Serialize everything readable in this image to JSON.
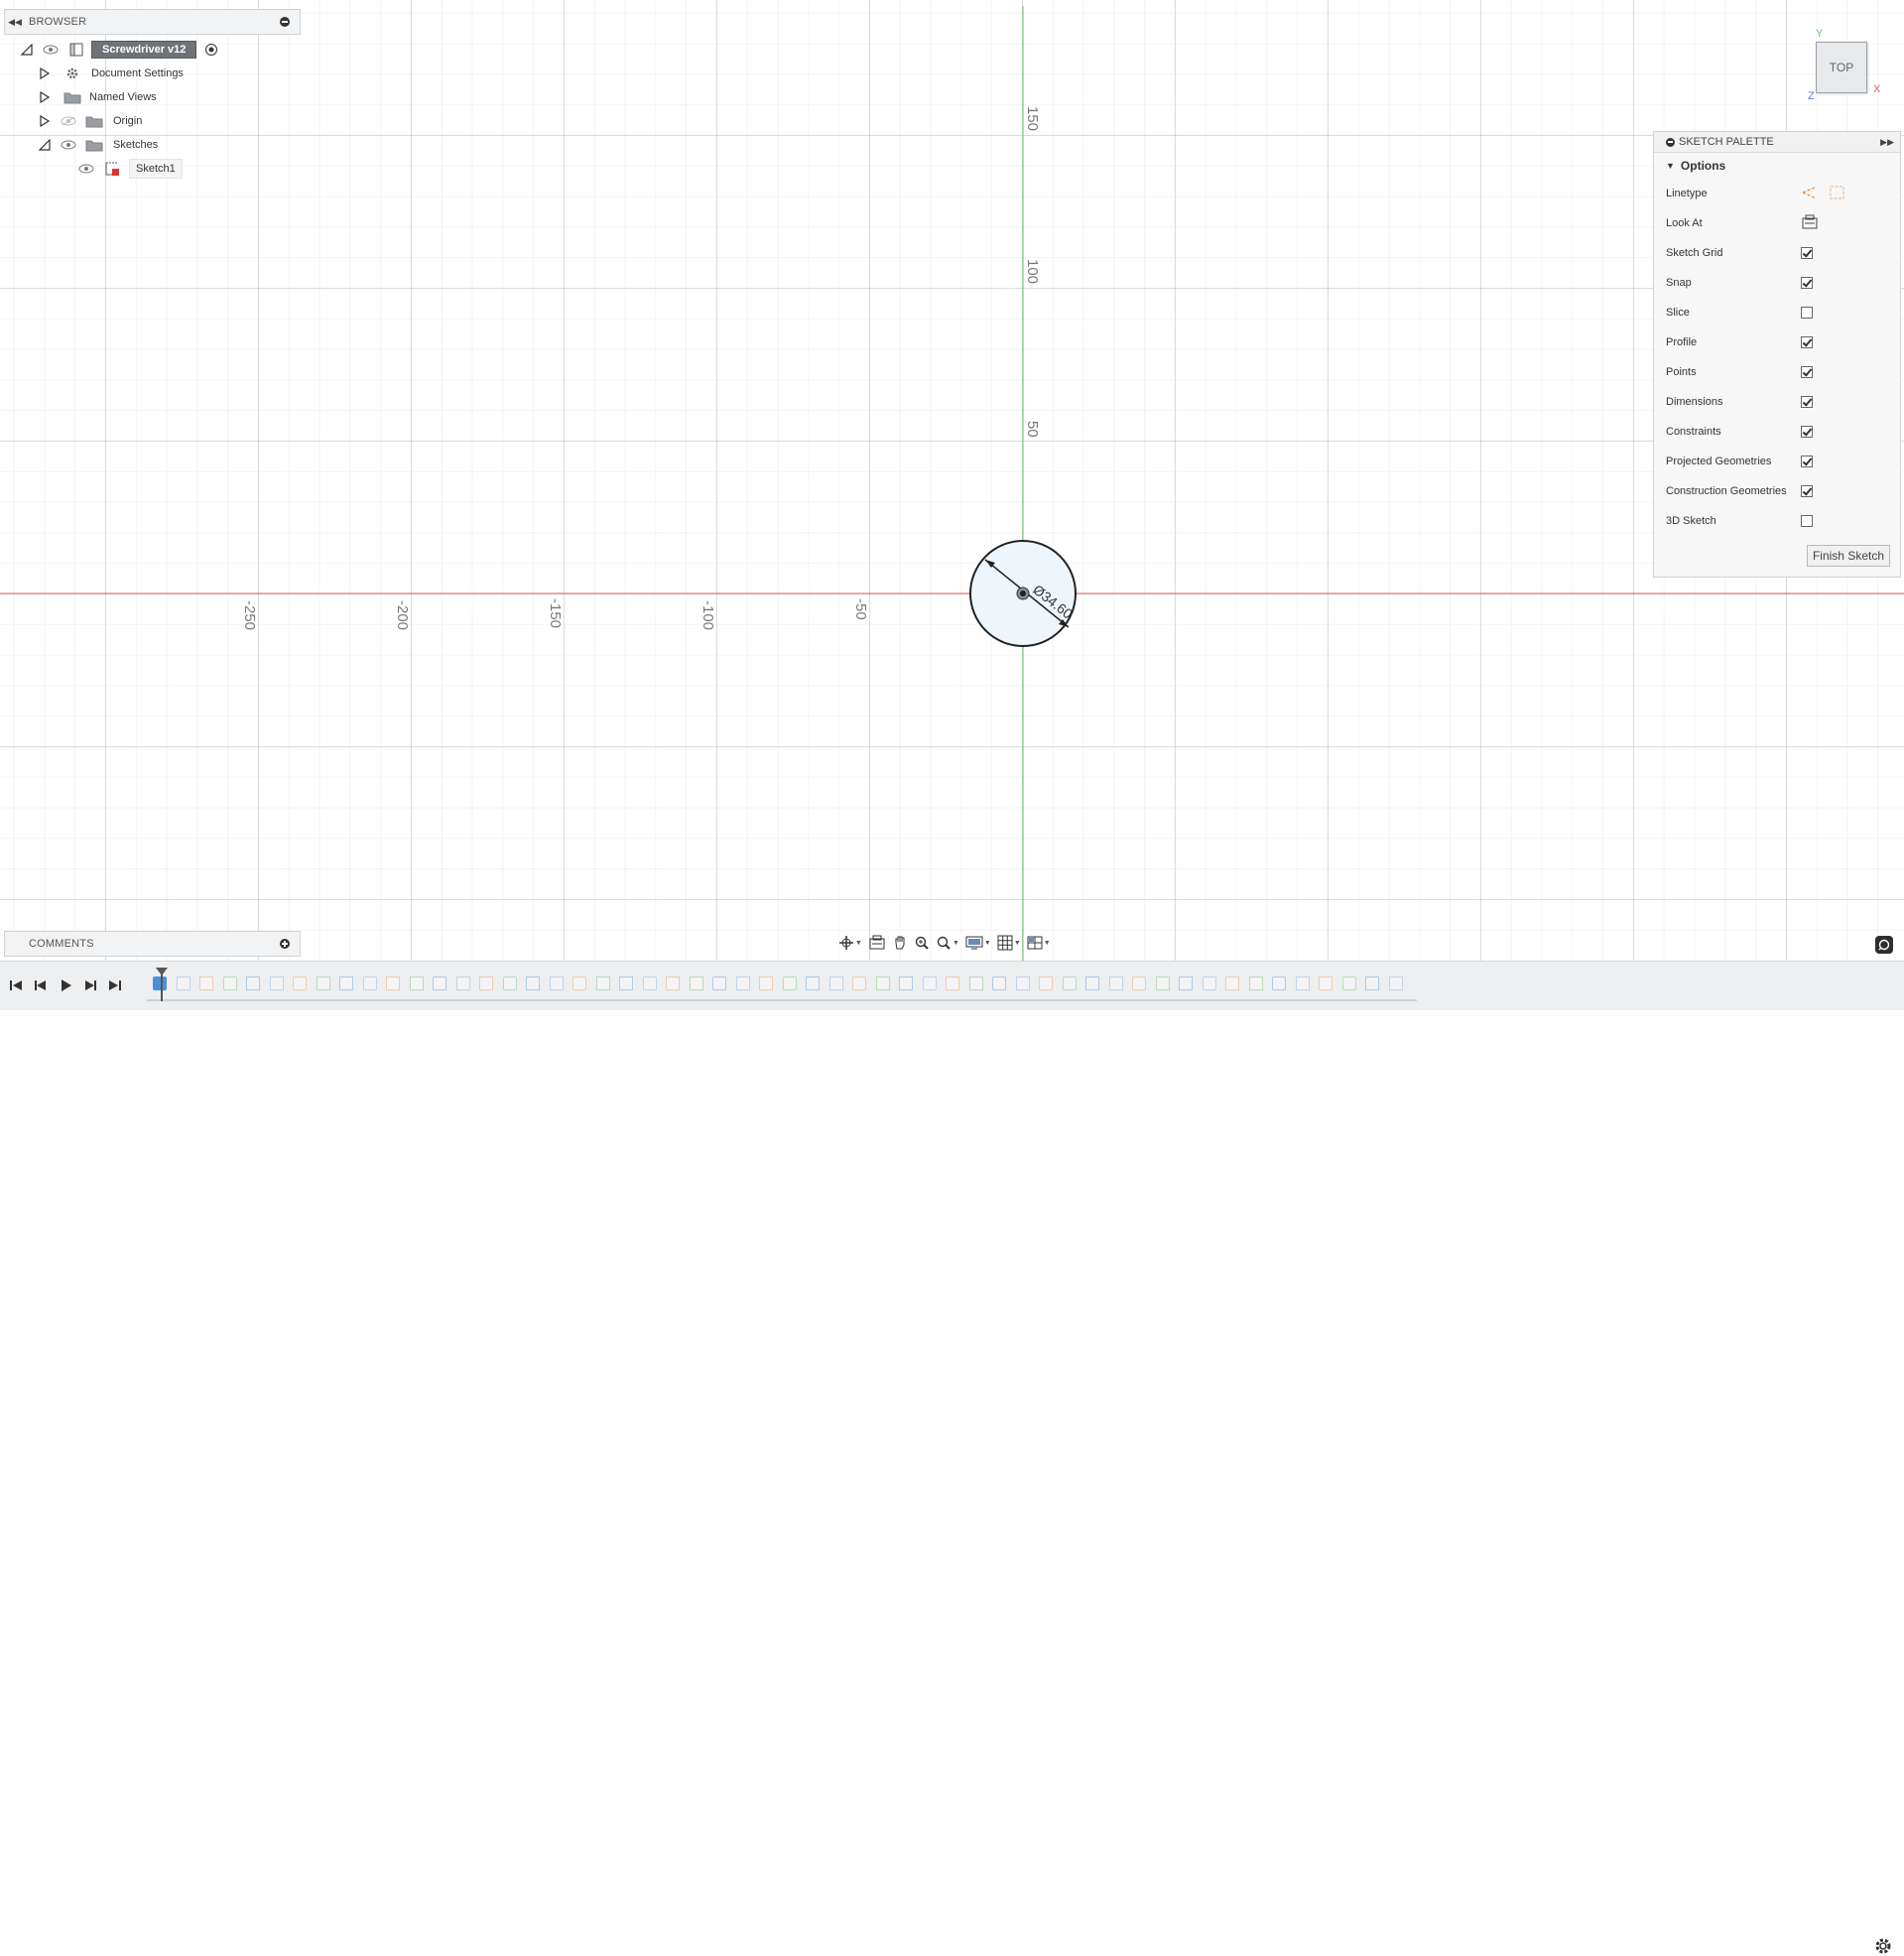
{
  "browser": {
    "title": "BROWSER",
    "root": "Screwdriver v12",
    "items": [
      {
        "label": "Document Settings",
        "icon": "gear-icon"
      },
      {
        "label": "Named Views",
        "icon": "folder-icon"
      },
      {
        "label": "Origin",
        "icon": "folder-icon"
      },
      {
        "label": "Sketches",
        "icon": "folder-icon"
      }
    ],
    "sketch_item": "Sketch1"
  },
  "canvas": {
    "x_axis_labels": [
      "-250",
      "-200",
      "-150",
      "-100",
      "-50"
    ],
    "y_axis_labels": [
      "150",
      "100",
      "50"
    ],
    "dimension_label": "Ø34.60",
    "x_axis_color": "#e06060",
    "y_axis_color": "#5ecb5e"
  },
  "viewcube": {
    "face_label": "TOP",
    "axis_x": "X",
    "axis_y": "Y",
    "axis_z": "Z"
  },
  "palette": {
    "title": "SKETCH PALETTE",
    "section": "Options",
    "linetype_label": "Linetype",
    "look_at_label": "Look At",
    "options": [
      {
        "label": "Sketch Grid",
        "checked": true
      },
      {
        "label": "Snap",
        "checked": true
      },
      {
        "label": "Slice",
        "checked": false
      },
      {
        "label": "Profile",
        "checked": true
      },
      {
        "label": "Points",
        "checked": true
      },
      {
        "label": "Dimensions",
        "checked": true
      },
      {
        "label": "Constraints",
        "checked": true
      },
      {
        "label": "Projected Geometries",
        "checked": true
      },
      {
        "label": "Construction Geometries",
        "checked": true
      },
      {
        "label": "3D Sketch",
        "checked": false
      }
    ],
    "finish_button": "Finish Sketch"
  },
  "comments": {
    "title": "COMMENTS"
  },
  "navbar": {
    "tools": [
      "orbit-icon",
      "look-at-icon",
      "pan-icon",
      "zoom-icon",
      "zoom-window-icon",
      "display-settings-icon",
      "grid-settings-icon",
      "viewports-icon"
    ]
  },
  "timeline": {
    "controls": [
      "first",
      "previous",
      "play",
      "next",
      "last"
    ],
    "feature_count": 55,
    "accent_color": "#4a90d9"
  }
}
